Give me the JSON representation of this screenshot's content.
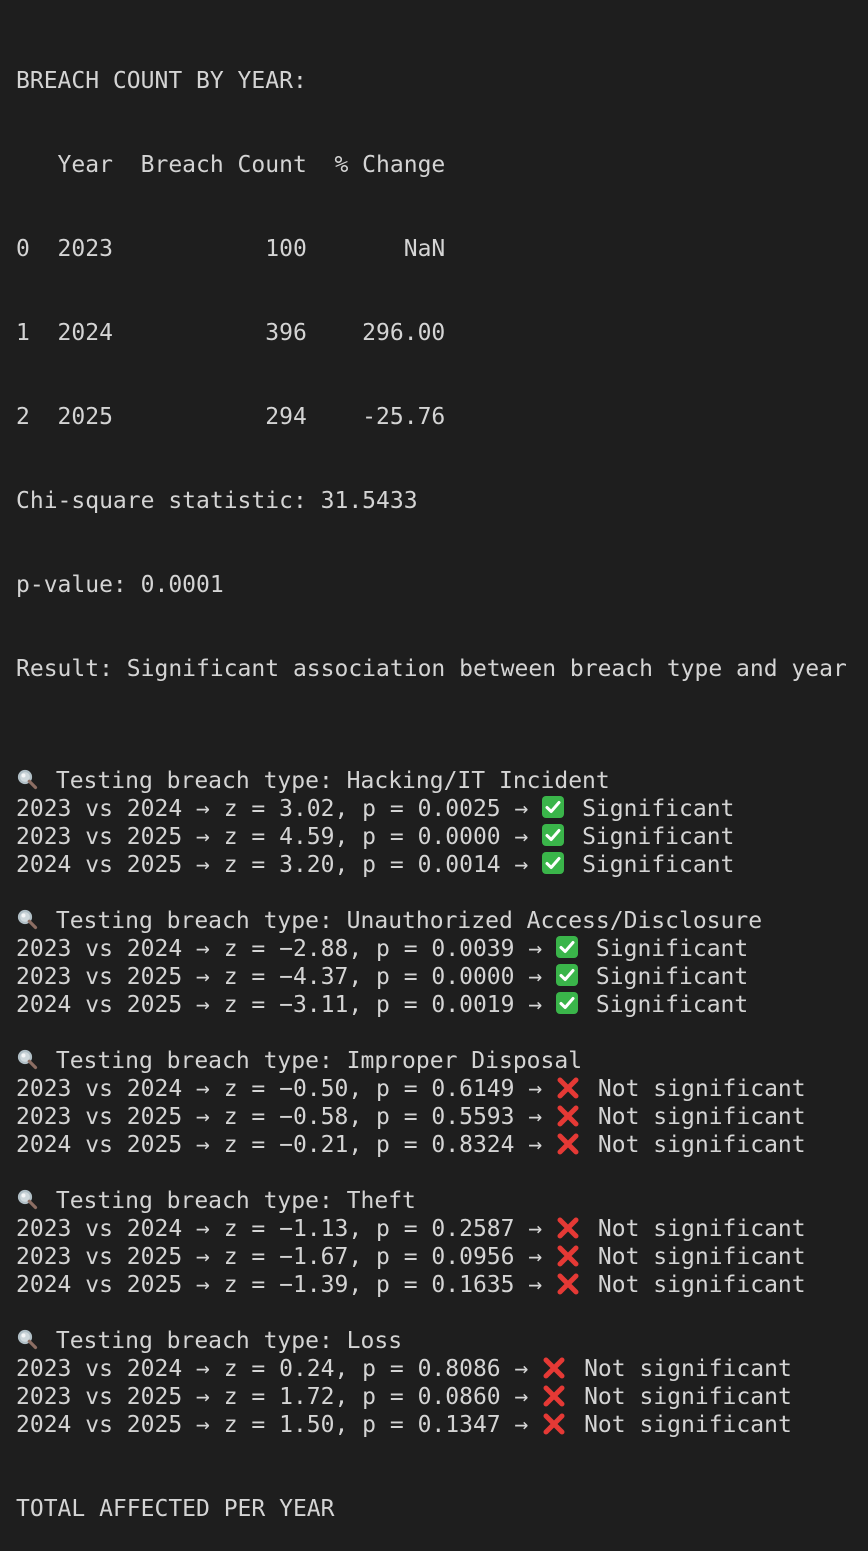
{
  "breach_count": {
    "title": "BREACH COUNT BY YEAR:",
    "table": {
      "header": "   Year  Breach Count  % Change",
      "rows": [
        "0  2023           100       NaN",
        "1  2024           396    296.00",
        "2  2025           294    -25.76"
      ]
    },
    "chi_square": "Chi-square statistic: 31.5433",
    "p_value": "p-value: 0.0001",
    "result": "Result: Significant association between breach type and year"
  },
  "tests": [
    {
      "header": "Testing breach type: Hacking/IT Incident",
      "rows": [
        {
          "text": "2023 vs 2024 → z = 3.02, p = 0.0025 →",
          "status": "Significant",
          "icon": "check-mark-icon"
        },
        {
          "text": "2023 vs 2025 → z = 4.59, p = 0.0000 →",
          "status": "Significant",
          "icon": "check-mark-icon"
        },
        {
          "text": "2024 vs 2025 → z = 3.20, p = 0.0014 →",
          "status": "Significant",
          "icon": "check-mark-icon"
        }
      ]
    },
    {
      "header": "Testing breach type: Unauthorized Access/Disclosure",
      "rows": [
        {
          "text": "2023 vs 2024 → z = −2.88, p = 0.0039 →",
          "status": "Significant",
          "icon": "check-mark-icon"
        },
        {
          "text": "2023 vs 2025 → z = −4.37, p = 0.0000 →",
          "status": "Significant",
          "icon": "check-mark-icon"
        },
        {
          "text": "2024 vs 2025 → z = −3.11, p = 0.0019 →",
          "status": "Significant",
          "icon": "check-mark-icon"
        }
      ]
    },
    {
      "header": "Testing breach type: Improper Disposal",
      "rows": [
        {
          "text": "2023 vs 2024 → z = −0.50, p = 0.6149 →",
          "status": "Not significant",
          "icon": "cross-mark-icon"
        },
        {
          "text": "2023 vs 2025 → z = −0.58, p = 0.5593 →",
          "status": "Not significant",
          "icon": "cross-mark-icon"
        },
        {
          "text": "2024 vs 2025 → z = −0.21, p = 0.8324 →",
          "status": "Not significant",
          "icon": "cross-mark-icon"
        }
      ]
    },
    {
      "header": "Testing breach type: Theft",
      "rows": [
        {
          "text": "2023 vs 2024 → z = −1.13, p = 0.2587 →",
          "status": "Not significant",
          "icon": "cross-mark-icon"
        },
        {
          "text": "2023 vs 2025 → z = −1.67, p = 0.0956 →",
          "status": "Not significant",
          "icon": "cross-mark-icon"
        },
        {
          "text": "2024 vs 2025 → z = −1.39, p = 0.1635 →",
          "status": "Not significant",
          "icon": "cross-mark-icon"
        }
      ]
    },
    {
      "header": "Testing breach type: Loss",
      "rows": [
        {
          "text": "2023 vs 2024 → z = 0.24, p = 0.8086 →",
          "status": "Not significant",
          "icon": "cross-mark-icon"
        },
        {
          "text": "2023 vs 2025 → z = 1.72, p = 0.0860 →",
          "status": "Not significant",
          "icon": "cross-mark-icon"
        },
        {
          "text": "2024 vs 2025 → z = 1.50, p = 0.1347 →",
          "status": "Not significant",
          "icon": "cross-mark-icon"
        }
      ]
    }
  ],
  "trailing_line": "TOTAL AFFECTED PER YEAR",
  "colors": {
    "background": "#1e1e1e",
    "text": "#d4d4d4",
    "check": "#3ab54a",
    "cross": "#e53935"
  }
}
